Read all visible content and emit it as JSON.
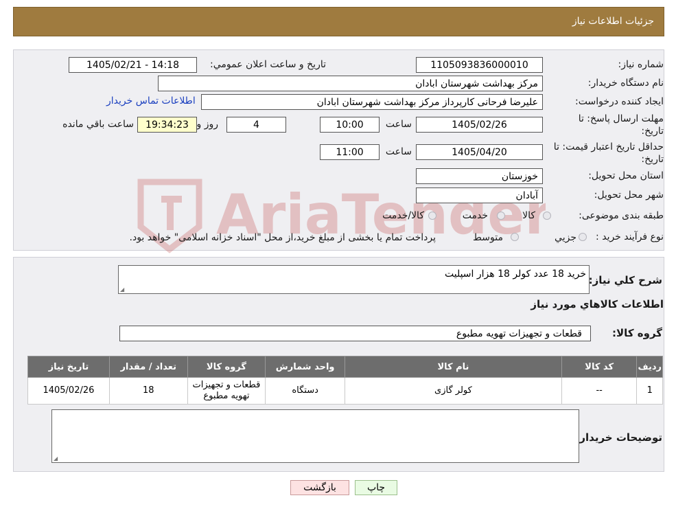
{
  "header": {
    "title": "جزئیات اطلاعات نیاز"
  },
  "form": {
    "need_number_label": "شماره نیاز:",
    "need_number": "1105093836000010",
    "announce_label": "تاریخ و ساعت اعلان عمومي:",
    "announce_value": "1405/02/21 - 14:18",
    "buyer_org_label": "نام دستگاه خريدار:",
    "buyer_org": "مرکز بهداشت شهرستان ابادان",
    "creator_label": "ایجاد کننده درخواست:",
    "creator": "علیرضا فرحانی کارپرداز مرکز بهداشت شهرستان ابادان",
    "contact_link": "اطلاعات تماس خریدار",
    "deadline_label": "مهلت ارسال پاسخ: تا تاریخ:",
    "deadline_date": "1405/02/26",
    "time_label": "ساعت",
    "deadline_time": "10:00",
    "days_value": "4",
    "days_label": "روز و",
    "remaining_time": "19:34:23",
    "remaining_label": "ساعت باقي مانده",
    "price_validity_label": "حداقل تاریخ اعتبار قیمت: تا تاریخ:",
    "price_validity_date": "1405/04/20",
    "price_validity_time": "11:00",
    "province_label": "استان محل تحویل:",
    "province": "خوزستان",
    "city_label": "شهر محل تحویل:",
    "city": "آبادان",
    "category_label": "طبقه بندی موضوعی:",
    "category_options": [
      "کالا",
      "خدمت",
      "کالا/خدمت"
    ],
    "process_label": "نوع فرآیند خرید :",
    "process_options": [
      "جزیي",
      "متوسط"
    ],
    "process_note": "پرداخت تمام یا بخشی از مبلغ خرید،از محل \"اسناد خزانه اسلامی\" خواهد بود."
  },
  "description": {
    "label": "شرح کلي نياز:",
    "value": "خرید 18 عدد کولر 18 هزار اسپلیت"
  },
  "goods_info_title": "اطلاعات کالاهاي مورد نياز",
  "goods_group": {
    "label": "گروه کالا:",
    "value": "قطعات و تجهیزات تهویه مطبوع"
  },
  "table": {
    "headers": [
      "رديف",
      "کد کالا",
      "نام کالا",
      "واحد شمارش",
      "گروه کالا",
      "تعداد / مقدار",
      "تاريخ نياز"
    ],
    "rows": [
      [
        "1",
        "--",
        "کولر گازی",
        "دستگاه",
        "قطعات و تجهیزات تهویه مطبوع",
        "18",
        "1405/02/26"
      ]
    ]
  },
  "buyer_notes": {
    "label": "توضیحات خریدار:",
    "value": ""
  },
  "buttons": {
    "print": "چاپ",
    "back": "بازگشت"
  },
  "watermark": {
    "text": "AriaTender.neT",
    "color": "#c24a4a"
  },
  "colors": {
    "header_bg": "#9f7b3f",
    "panel_bg": "#efeff2",
    "table_header": "#6d6d6d",
    "link": "#1a3fbf",
    "timer_bg": "#ffffcc"
  }
}
